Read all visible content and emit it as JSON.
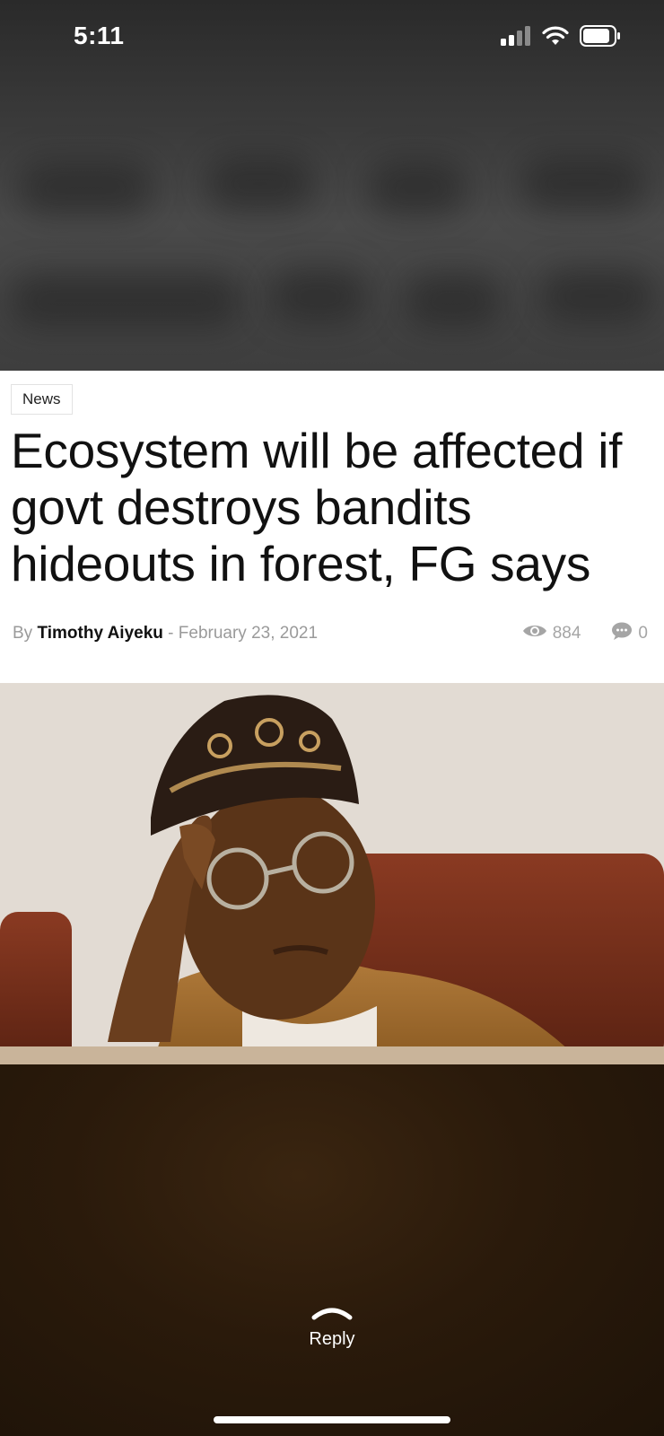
{
  "status_bar": {
    "time": "5:11",
    "icons": [
      "cellular-signal-icon",
      "wifi-icon",
      "battery-icon"
    ]
  },
  "article": {
    "category": "News",
    "headline": "Ecosystem will be affected if govt destroys bandits hideouts in forest, FG says",
    "by_label": "By",
    "author": "Timothy Aiyeku",
    "separator": "-",
    "date": "February 23, 2021",
    "views": "884",
    "comments": "0"
  },
  "photo": {
    "icon": "news-photo-man-in-cap"
  },
  "reply": {
    "label": "Reply",
    "icon": "chevron-up-icon"
  },
  "colors": {
    "card_background": "#ffffff",
    "headline_text": "#111111",
    "meta_text": "#9a9a9a",
    "reply_text": "#ffffff"
  }
}
